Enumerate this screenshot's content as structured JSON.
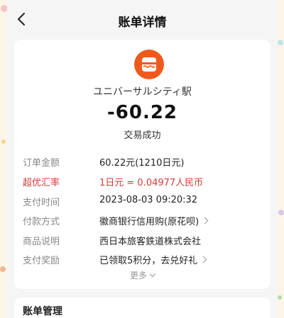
{
  "header": {
    "title": "账单详情"
  },
  "merchant": {
    "name": "ユニバーサルシティ駅",
    "icon": "merchant-store-icon",
    "icon_color": "#ef5a1c"
  },
  "amount": "-60.22",
  "status": "交易成功",
  "details": [
    {
      "label": "订单金额",
      "value": "60.22元(1210日元)",
      "chevron": false,
      "highlight": false
    },
    {
      "label": "超优汇率",
      "value": "1日元 = 0.04977人民币",
      "chevron": false,
      "highlight": true
    },
    {
      "label": "支付时间",
      "value": "2023-08-03 09:20:32",
      "chevron": false,
      "highlight": false
    },
    {
      "label": "付款方式",
      "value": "徽商银行信用购(原花呗)",
      "chevron": true,
      "highlight": false
    },
    {
      "label": "商品说明",
      "value": "西日本旅客鉄道株式会社",
      "chevron": false,
      "highlight": false
    },
    {
      "label": "支付奖励",
      "value": "已领取5积分，去兑好礼",
      "chevron": true,
      "highlight": false
    }
  ],
  "more_label": "更多",
  "manage": {
    "title": "账单管理"
  },
  "colors": {
    "highlight": "#d23a3a",
    "background": "#f5f5f5",
    "card": "#ffffff"
  }
}
